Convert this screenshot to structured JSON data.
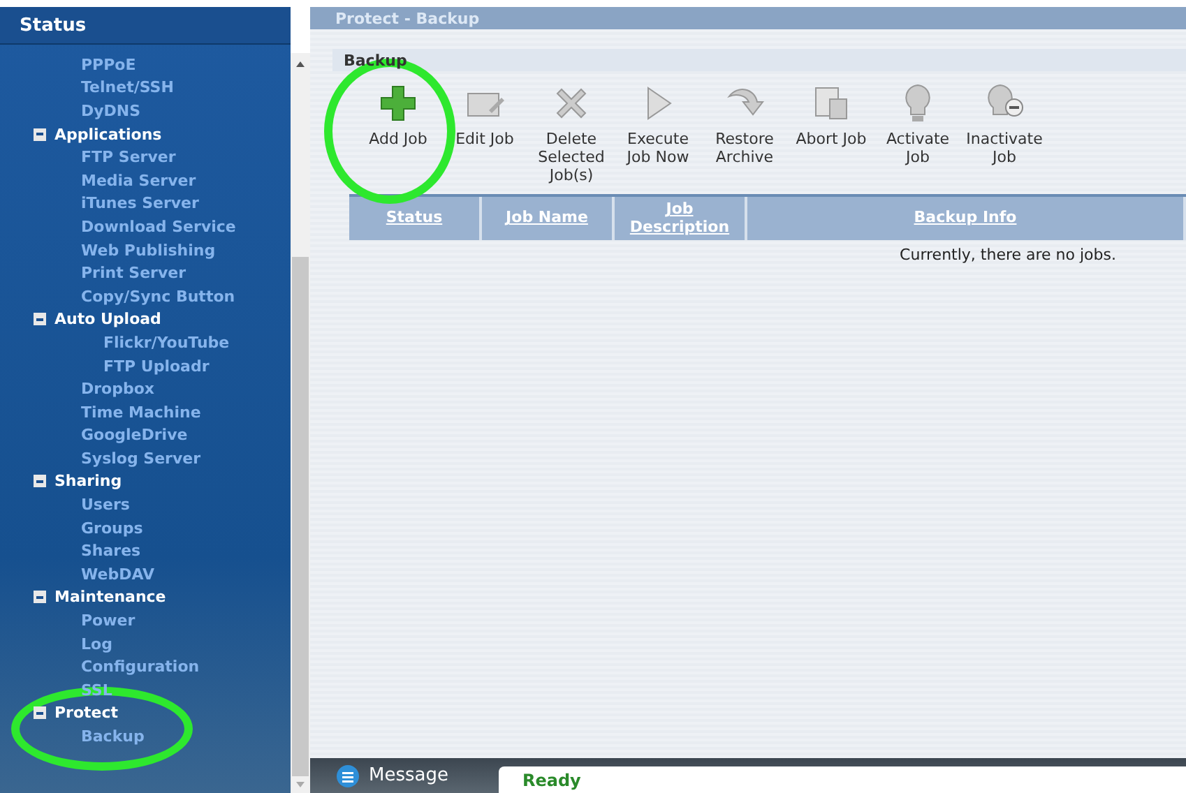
{
  "sidebar": {
    "title": "Status",
    "items": [
      {
        "label": "PPPoE"
      },
      {
        "label": "Telnet/SSH"
      },
      {
        "label": "DyDNS"
      },
      {
        "label": "Applications",
        "expanded": true,
        "children": [
          {
            "label": "FTP Server"
          },
          {
            "label": "Media Server"
          },
          {
            "label": "iTunes Server"
          },
          {
            "label": "Download Service"
          },
          {
            "label": "Web Publishing"
          },
          {
            "label": "Print Server"
          },
          {
            "label": "Copy/Sync Button"
          },
          {
            "label": "Auto Upload",
            "expanded": true,
            "children": [
              {
                "label": "Flickr/YouTube"
              },
              {
                "label": "FTP Uploadr"
              }
            ]
          },
          {
            "label": "Dropbox"
          },
          {
            "label": "Time Machine"
          },
          {
            "label": "GoogleDrive"
          },
          {
            "label": "Syslog Server"
          }
        ]
      },
      {
        "label": "Sharing",
        "expanded": true,
        "children": [
          {
            "label": "Users"
          },
          {
            "label": "Groups"
          },
          {
            "label": "Shares"
          },
          {
            "label": "WebDAV"
          }
        ]
      },
      {
        "label": "Maintenance",
        "expanded": true,
        "children": [
          {
            "label": "Power"
          },
          {
            "label": "Log"
          },
          {
            "label": "Configuration"
          },
          {
            "label": "SSL"
          }
        ]
      },
      {
        "label": "Protect",
        "expanded": true,
        "children": [
          {
            "label": "Backup"
          }
        ]
      }
    ]
  },
  "page_title": "Protect - Backup",
  "section_title": "Backup",
  "toolbar": [
    {
      "kind": "add",
      "label": "Add Job"
    },
    {
      "kind": "edit",
      "label": "Edit Job"
    },
    {
      "kind": "delete",
      "label": "Delete Selected Job(s)"
    },
    {
      "kind": "execute",
      "label": "Execute Job Now"
    },
    {
      "kind": "restore",
      "label": "Restore Archive"
    },
    {
      "kind": "abort",
      "label": "Abort Job"
    },
    {
      "kind": "activate",
      "label": "Activate Job"
    },
    {
      "kind": "inactivate",
      "label": "Inactivate Job"
    }
  ],
  "table": {
    "columns": [
      "Status",
      "Job Name",
      "Job Description",
      "Backup Info"
    ],
    "empty_message": "Currently, there are no jobs."
  },
  "status_bar": {
    "label": "Message",
    "value": "Ready"
  }
}
